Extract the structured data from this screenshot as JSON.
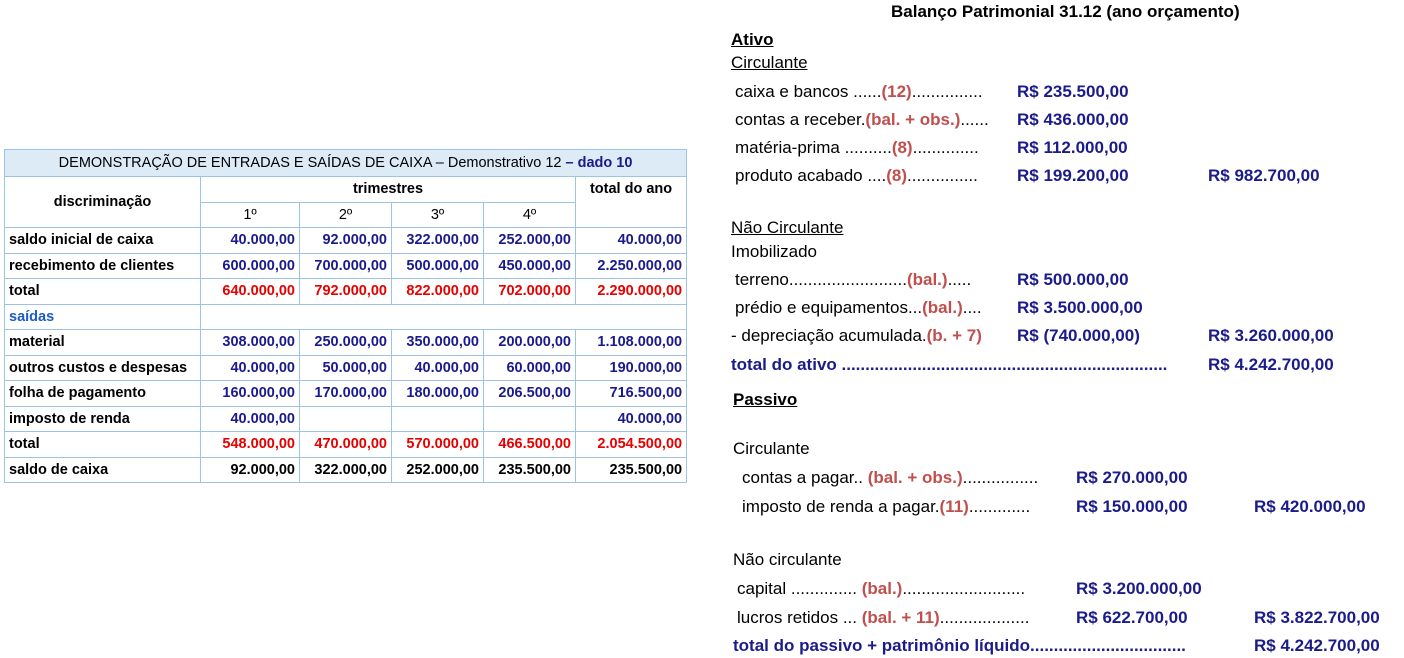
{
  "cash_table": {
    "caption_main": "DEMONSTRAÇÃO DE ENTRADAS E SAÍDAS DE CAIXA – Demonstrativo 12 ",
    "caption_tail": "– dado 10",
    "col_discriminacao": "discriminação",
    "col_trimestres": "trimestres",
    "col_total": "total do ano",
    "quarters": [
      "1º",
      "2º",
      "3º",
      "4º"
    ],
    "rows": [
      {
        "label": "saldo inicial de caixa",
        "values": [
          "40.000,00",
          "92.000,00",
          "322.000,00",
          "252.000,00",
          "40.000,00"
        ]
      },
      {
        "label": "recebimento de clientes",
        "values": [
          "600.000,00",
          "700.000,00",
          "500.000,00",
          "450.000,00",
          "2.250.000,00"
        ]
      },
      {
        "label": "total",
        "values": [
          "640.000,00",
          "792.000,00",
          "822.000,00",
          "702.000,00",
          "2.290.000,00"
        ]
      },
      {
        "label": "saídas",
        "values": [
          "",
          "",
          "",
          "",
          ""
        ]
      },
      {
        "label": "material",
        "values": [
          "308.000,00",
          "250.000,00",
          "350.000,00",
          "200.000,00",
          "1.108.000,00"
        ]
      },
      {
        "label": "outros custos e despesas",
        "values": [
          "40.000,00",
          "50.000,00",
          "40.000,00",
          "60.000,00",
          "190.000,00"
        ]
      },
      {
        "label": "folha de pagamento",
        "values": [
          "160.000,00",
          "170.000,00",
          "180.000,00",
          "206.500,00",
          "716.500,00"
        ]
      },
      {
        "label": "imposto de renda",
        "values": [
          "40.000,00",
          "",
          "",
          "",
          "40.000,00"
        ]
      },
      {
        "label": "total",
        "values": [
          "548.000,00",
          "470.000,00",
          "570.000,00",
          "466.500,00",
          "2.054.500,00"
        ]
      },
      {
        "label": "saldo de caixa",
        "values": [
          "92.000,00",
          "322.000,00",
          "252.000,00",
          "235.500,00",
          "235.500,00"
        ]
      }
    ]
  },
  "balance": {
    "title": "Balanço Patrimonial 31.12 (ano orçamento)",
    "ativo": "Ativo",
    "circulante": "Circulante",
    "caixa": {
      "pre": "caixa e bancos ......",
      "ref": "(12)",
      "post": "...............",
      "value": "R$ 235.500,00"
    },
    "contas_receber": {
      "pre": "contas a receber.",
      "ref": "(bal. + obs.)",
      "post": "......",
      "value": "R$ 436.000,00"
    },
    "materia_prima": {
      "pre": "matéria-prima ..........",
      "ref": "(8)",
      "post": "..............",
      "value": "R$ 112.000,00"
    },
    "produto_acabado": {
      "pre": "produto acabado ....",
      "ref": "(8)",
      "post": "...............",
      "value": "R$ 199.200,00",
      "subtotal": "R$ 982.700,00"
    },
    "nao_circulante": "Não Circulante",
    "imobilizado": "Imobilizado",
    "terreno": {
      "pre": "terreno.........................",
      "ref": "(bal.)",
      "post": ".....",
      "value": "R$ 500.000,00"
    },
    "predio": {
      "pre": "prédio e equipamentos...",
      "ref": "(bal.)",
      "post": "....",
      "value": "R$ 3.500.000,00"
    },
    "depreciacao": {
      "pre": "- depreciação acumulada.",
      "ref": "(b. + 7)",
      "post": "",
      "value": "R$ (740.000,00)",
      "subtotal": "R$ 3.260.000,00"
    },
    "total_ativo": {
      "label": "total do ativo .....................................................................",
      "value": "R$ 4.242.700,00"
    },
    "passivo": "Passivo",
    "passivo_circulante": "Circulante",
    "contas_pagar": {
      "pre": "contas a pagar.. ",
      "ref": "(bal. + obs.)",
      "post": "................",
      "value": "R$ 270.000,00"
    },
    "ir_pagar": {
      "pre": "imposto de renda a pagar.",
      "ref": "(11)",
      "post": ".............",
      "value": "R$ 150.000,00",
      "subtotal": "R$ 420.000,00"
    },
    "passivo_nao_circulante": "Não circulante",
    "capital": {
      "pre": "capital .............. ",
      "ref": "(bal.)",
      "post": "..........................",
      "value": "R$ 3.200.000,00"
    },
    "lucros": {
      "pre": "lucros retidos ... ",
      "ref": "(bal. + 11)",
      "post": "...................",
      "value": "R$ 622.700,00",
      "subtotal": "R$ 3.822.700,00"
    },
    "total_passivo": {
      "label": "total do passivo + patrimônio líquido.................................",
      "value": "R$ 4.242.700,00"
    }
  }
}
